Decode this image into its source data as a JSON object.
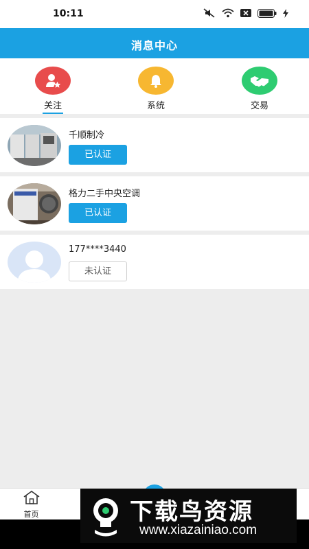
{
  "status_bar": {
    "time": "10:11"
  },
  "header": {
    "title": "消息中心"
  },
  "tabs": [
    {
      "label": "关注",
      "icon": "user-star-icon",
      "color": "#e84c4c",
      "active": true
    },
    {
      "label": "系统",
      "icon": "bell-icon",
      "color": "#f7b731",
      "active": false
    },
    {
      "label": "交易",
      "icon": "handshake-icon",
      "color": "#2ecc71",
      "active": false
    }
  ],
  "accent_color": "#1ba1e2",
  "list": [
    {
      "name": "千顺制冷",
      "status": "已认证",
      "certified": true,
      "avatar": "ac-units-photo"
    },
    {
      "name": "格力二手中央空调",
      "status": "已认证",
      "certified": true,
      "avatar": "ac-unit-photo"
    },
    {
      "name": "177****3440",
      "status": "未认证",
      "certified": false,
      "avatar": "default-avatar"
    }
  ],
  "bottom_nav": {
    "home_label": "首页"
  },
  "watermark": {
    "title": "下载鸟资源",
    "url": "www.xiazainiao.com"
  }
}
